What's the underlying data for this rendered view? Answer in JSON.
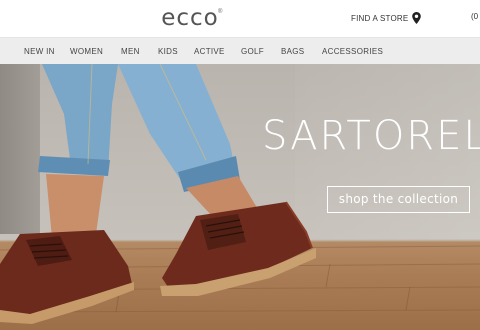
{
  "header": {
    "logo_text": "ecco",
    "find_store_label": "FIND A STORE",
    "cart_count": "(0"
  },
  "nav": {
    "items": [
      "NEW IN",
      "WOMEN",
      "MEN",
      "KIDS",
      "ACTIVE",
      "GOLF",
      "BAGS",
      "ACCESSORIES"
    ]
  },
  "hero": {
    "headline": "SARTOREL",
    "cta_label": "shop the collection"
  },
  "colors": {
    "nav_background": "#ededed",
    "shoe_leather": "#6b2a1c",
    "denim": "#6f9fc4"
  },
  "icons": [
    "map-pin-icon"
  ]
}
